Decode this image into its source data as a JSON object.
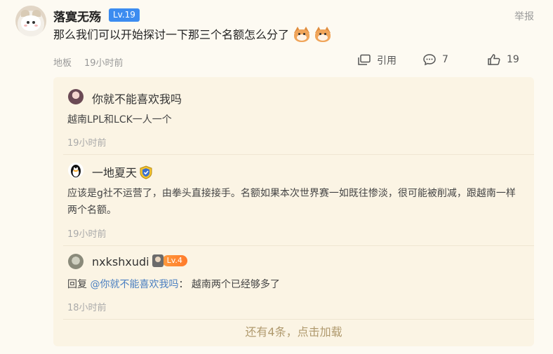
{
  "post": {
    "username": "落寞无殇",
    "level": "Lv.19",
    "report_label": "举报",
    "text": "那么我们可以开始探讨一下那三个名额怎么分了",
    "emojis": [
      "cat-emoji",
      "cat-emoji"
    ],
    "floor": "地板",
    "time": "19小时前",
    "actions": {
      "quote_label": "引用",
      "comment_count": "7",
      "like_count": "19"
    }
  },
  "replies": [
    {
      "username": "你就不能喜欢我吗",
      "text": "越南LPL和LCK一人一个",
      "time": "19小时前"
    },
    {
      "username": "一地夏天",
      "badge_icon": "shield-badge-icon",
      "text": "应该是g社不运营了，由拳头直接接手。名额如果本次世界赛一如既往惨淡，很可能被削减，跟越南一样两个名额。",
      "time": "19小时前"
    },
    {
      "username": "nxkshxudi",
      "level": "Lv.4",
      "reply_prefix": "回复",
      "mention": "@你就不能喜欢我吗",
      "reply_sep": "：",
      "text": "越南两个已经够多了",
      "time": "18小时前"
    }
  ],
  "load_more": "还有4条，点击加载",
  "colors": {
    "background": "#fdfaf2",
    "subcomment_bg": "#fbf4e4",
    "level_badge": "#3c8cf0",
    "mention": "#4a7fc1",
    "load_more": "#b09a6e"
  }
}
